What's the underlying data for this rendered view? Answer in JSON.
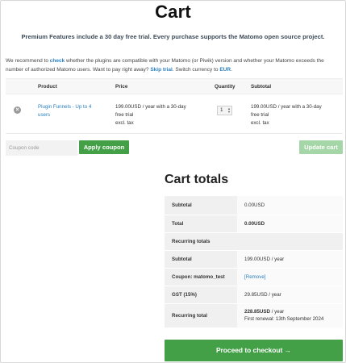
{
  "page": {
    "title": "Cart",
    "promo": "Premium Features include a 30 day free trial. Every purchase supports the Matomo open source project."
  },
  "recommend": {
    "part1": "We recommend to ",
    "check_link": "check",
    "part2": " whether the plugins are compatible with your Matomo (or Piwik) version and whether your Matomo exceeds the number of authorized Matomo users. Want to pay right away? ",
    "skip_trial_link": "Skip trial",
    "part3": ". Switch currency to ",
    "currency_link": "EUR",
    "part4": "."
  },
  "cart_table": {
    "headers": {
      "product": "Product",
      "price": "Price",
      "quantity": "Quantity",
      "subtotal": "Subtotal"
    },
    "rows": [
      {
        "remove": "×",
        "product": "Plugin Funnels - Up to 4 users",
        "price_line1": "199.00USD / year with a 30-day",
        "price_line2": "free trial",
        "price_line3": "excl. tax",
        "quantity": "1",
        "subtotal_line1": "199.00USD / year with a 30-day",
        "subtotal_line2": "free trial",
        "subtotal_line3": "excl. tax"
      }
    ]
  },
  "coupon": {
    "placeholder": "Coupon code",
    "apply_label": "Apply coupon",
    "update_label": "Update cart"
  },
  "totals": {
    "title": "Cart totals",
    "subtotal_label": "Subtotal",
    "subtotal_value": "0.00USD",
    "total_label": "Total",
    "total_value": "0.00USD",
    "recurring_header": "Recurring totals",
    "recurring_subtotal_label": "Subtotal",
    "recurring_subtotal_value": "199.00USD / year",
    "coupon_label": "Coupon: matomo_test",
    "coupon_remove": "[Remove]",
    "gst_label": "GST (15%)",
    "gst_value": "29.85USD / year",
    "recurring_total_label": "Recurring total",
    "recurring_total_value": "228.85USD",
    "recurring_total_period": " / year",
    "first_renewal": "First renewal: 13th September 2024"
  },
  "checkout": {
    "label": "Proceed to checkout",
    "arrow": "→"
  },
  "colors": {
    "accent_green": "#43a047",
    "disabled_green": "#a5d6a7",
    "link_blue": "#2a7fc0"
  }
}
